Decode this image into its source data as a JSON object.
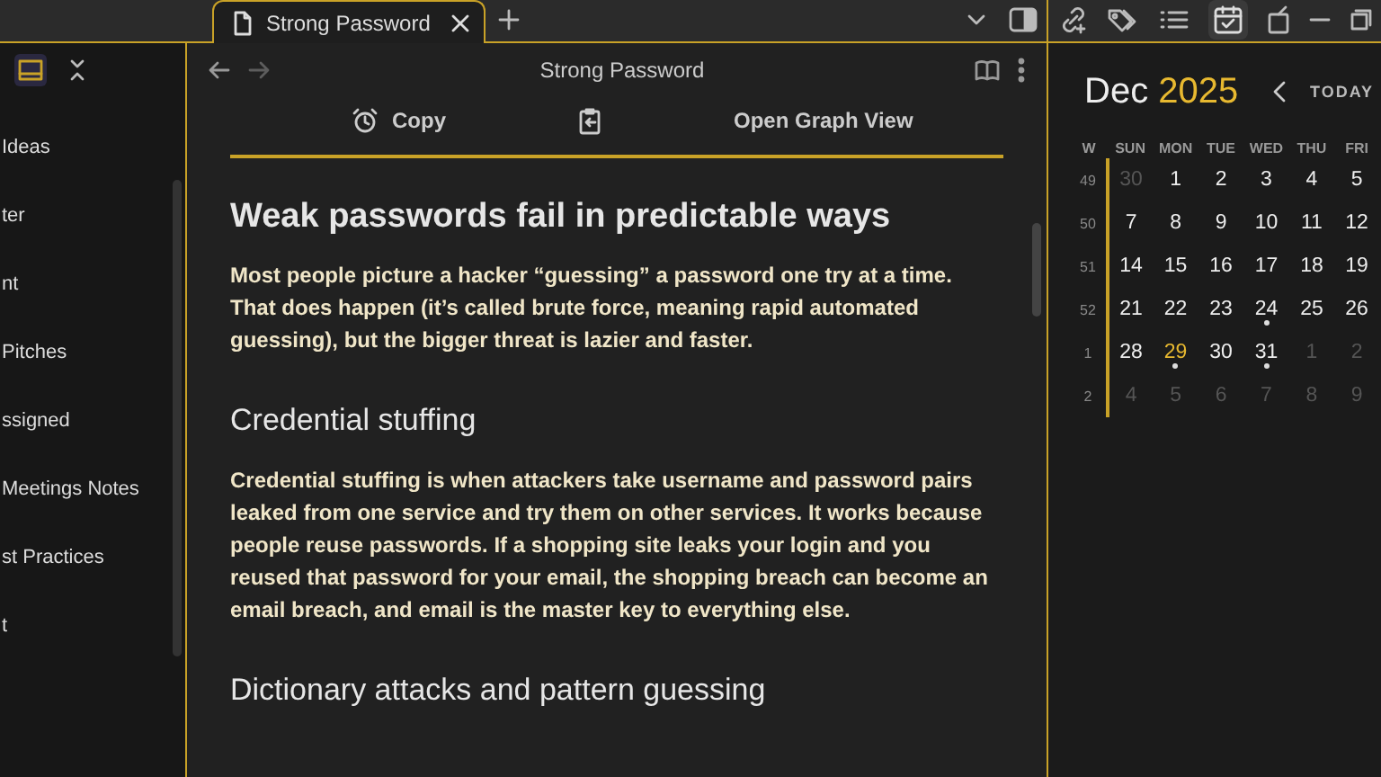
{
  "tabs": [
    {
      "label": "Strong Password",
      "selected": true
    }
  ],
  "sidebar": {
    "items": [
      "Ideas",
      "ter",
      "nt",
      "Pitches",
      "ssigned",
      "Meetings Notes",
      "st Practices",
      "t"
    ]
  },
  "editor": {
    "title": "Strong Password",
    "toolbar": [
      {
        "kind": "alarm",
        "label": "Copy"
      },
      {
        "kind": "clipboard"
      },
      {
        "kind": "text",
        "label": "Open Graph View"
      }
    ],
    "content": [
      {
        "kind": "heading",
        "text": "Weak passwords fail in predictable ways"
      },
      {
        "kind": "paragraph",
        "text": "Most people picture a hacker “guessing” a password one try at a time. That does happen (it’s called brute force, meaning rapid automated guessing), but the bigger threat is lazier and faster."
      },
      {
        "kind": "subheading",
        "text": "Credential stuffing"
      },
      {
        "kind": "paragraph",
        "text": "Credential stuffing is when attackers take username and password pairs leaked from one service and try them on other services. It works because people reuse passwords. If a shopping site leaks your login and you reused that password for your email, the shopping breach can become an email breach, and email is the master key to everything else."
      },
      {
        "kind": "subheading",
        "text": "Dictionary attacks and pattern guessing"
      }
    ]
  },
  "calendar": {
    "month": "Dec",
    "year": "2025",
    "today_label": "TODAY",
    "weekdays": [
      "W",
      "SUN",
      "MON",
      "TUE",
      "WED",
      "THU",
      "FRI"
    ],
    "weeks": [
      {
        "week": "49",
        "days": [
          {
            "day": "30",
            "muted": true,
            "today": false,
            "dot": false
          },
          {
            "day": "1",
            "muted": false,
            "today": false,
            "dot": false
          },
          {
            "day": "2",
            "muted": false,
            "today": false,
            "dot": false
          },
          {
            "day": "3",
            "muted": false,
            "today": false,
            "dot": false
          },
          {
            "day": "4",
            "muted": false,
            "today": false,
            "dot": false
          },
          {
            "day": "5",
            "muted": false,
            "today": false,
            "dot": false
          }
        ]
      },
      {
        "week": "50",
        "days": [
          {
            "day": "7",
            "muted": false,
            "today": false,
            "dot": false
          },
          {
            "day": "8",
            "muted": false,
            "today": false,
            "dot": false
          },
          {
            "day": "9",
            "muted": false,
            "today": false,
            "dot": false
          },
          {
            "day": "10",
            "muted": false,
            "today": false,
            "dot": false
          },
          {
            "day": "11",
            "muted": false,
            "today": false,
            "dot": false
          },
          {
            "day": "12",
            "muted": false,
            "today": false,
            "dot": false
          }
        ]
      },
      {
        "week": "51",
        "days": [
          {
            "day": "14",
            "muted": false,
            "today": false,
            "dot": false
          },
          {
            "day": "15",
            "muted": false,
            "today": false,
            "dot": false
          },
          {
            "day": "16",
            "muted": false,
            "today": false,
            "dot": false
          },
          {
            "day": "17",
            "muted": false,
            "today": false,
            "dot": false
          },
          {
            "day": "18",
            "muted": false,
            "today": false,
            "dot": false
          },
          {
            "day": "19",
            "muted": false,
            "today": false,
            "dot": false
          }
        ]
      },
      {
        "week": "52",
        "days": [
          {
            "day": "21",
            "muted": false,
            "today": false,
            "dot": false
          },
          {
            "day": "22",
            "muted": false,
            "today": false,
            "dot": false
          },
          {
            "day": "23",
            "muted": false,
            "today": false,
            "dot": false
          },
          {
            "day": "24",
            "muted": false,
            "today": false,
            "dot": true
          },
          {
            "day": "25",
            "muted": false,
            "today": false,
            "dot": false
          },
          {
            "day": "26",
            "muted": false,
            "today": false,
            "dot": false
          }
        ]
      },
      {
        "week": "1",
        "days": [
          {
            "day": "28",
            "muted": false,
            "today": false,
            "dot": false
          },
          {
            "day": "29",
            "muted": false,
            "today": true,
            "dot": true
          },
          {
            "day": "30",
            "muted": false,
            "today": false,
            "dot": false
          },
          {
            "day": "31",
            "muted": false,
            "today": false,
            "dot": true
          },
          {
            "day": "1",
            "muted": true,
            "today": false,
            "dot": false
          },
          {
            "day": "2",
            "muted": true,
            "today": false,
            "dot": false
          }
        ]
      },
      {
        "week": "2",
        "days": [
          {
            "day": "4",
            "muted": true,
            "today": false,
            "dot": false
          },
          {
            "day": "5",
            "muted": true,
            "today": false,
            "dot": false
          },
          {
            "day": "6",
            "muted": true,
            "today": false,
            "dot": false
          },
          {
            "day": "7",
            "muted": true,
            "today": false,
            "dot": false
          },
          {
            "day": "8",
            "muted": true,
            "today": false,
            "dot": false
          },
          {
            "day": "9",
            "muted": true,
            "today": false,
            "dot": false
          }
        ]
      }
    ]
  }
}
